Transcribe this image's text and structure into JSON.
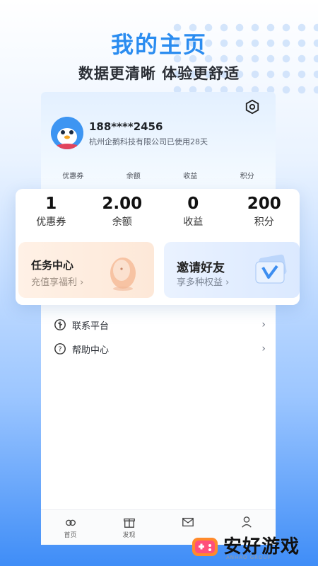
{
  "hero": {
    "title": "我的主页",
    "subtitle": "数据更清晰 体验更舒适"
  },
  "profile": {
    "phone": "188****2456",
    "company_text": "杭州企鹅科技有限公司已使用28天"
  },
  "mini_stats": [
    "优惠券",
    "余额",
    "收益",
    "积分"
  ],
  "stats": [
    {
      "value": "1",
      "label": "优惠券"
    },
    {
      "value": "2.00",
      "label": "余额"
    },
    {
      "value": "0",
      "label": "收益"
    },
    {
      "value": "200",
      "label": "积分"
    }
  ],
  "tiles": {
    "task": {
      "title": "任务中心",
      "subtitle": "充值享福利"
    },
    "invite": {
      "title": "邀请好友",
      "subtitle": "享多种权益"
    }
  },
  "menu": [
    {
      "label": "联系平台",
      "icon": "tree-icon"
    },
    {
      "label": "帮助中心",
      "icon": "help-icon"
    }
  ],
  "tabbar": [
    {
      "label": "首页",
      "icon": "home-icon"
    },
    {
      "label": "发现",
      "icon": "gift-icon"
    },
    {
      "label": "",
      "icon": "mail-icon"
    },
    {
      "label": "",
      "icon": "user-icon"
    }
  ],
  "watermark": {
    "text": "安好游戏",
    "small": "ANHAO GROUP"
  },
  "colors": {
    "accent": "#2a8cf0",
    "task_bg": "#fde8d8",
    "invite_bg": "#dbe9ff"
  }
}
